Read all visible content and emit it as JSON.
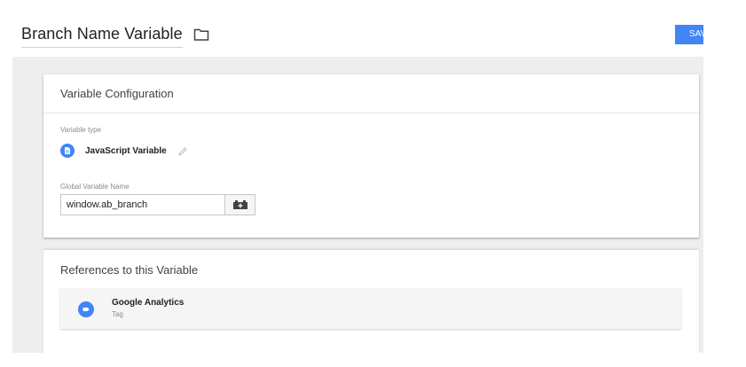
{
  "header": {
    "title": "Branch Name Variable",
    "save_label": "SAVE"
  },
  "config_card": {
    "title": "Variable Configuration",
    "variable_type_label": "Variable type",
    "variable_type": "JavaScript Variable",
    "global_variable_name_label": "Global Variable Name",
    "global_variable_name_value": "window.ab_branch"
  },
  "references_card": {
    "title": "References to this Variable",
    "items": [
      {
        "name": "Google Analytics",
        "type": "Tag"
      }
    ]
  },
  "icons": {
    "folder": "folder-icon",
    "variable_type": "document-icon",
    "edit": "pencil-icon",
    "variable_picker": "brick-plus-icon",
    "tag": "tag-icon"
  },
  "colors": {
    "accent": "#4285f4",
    "background": "#eeeeee"
  }
}
